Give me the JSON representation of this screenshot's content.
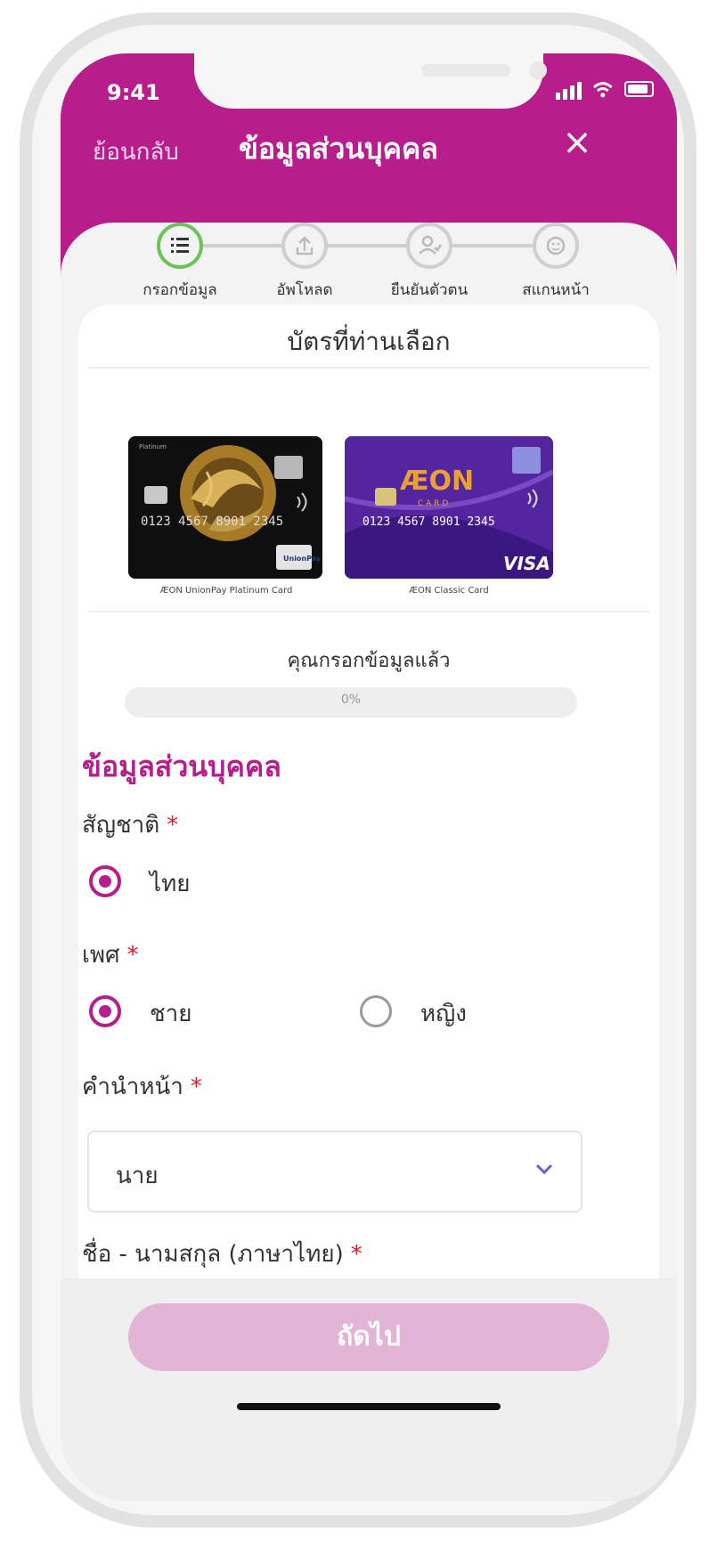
{
  "status_bar": {
    "time": "9:41"
  },
  "nav": {
    "back_label": "ย้อนกลับ",
    "title": "ข้อมูลส่วนบุคคล",
    "close_icon": "×"
  },
  "steps": [
    {
      "label": "กรอกข้อมูล",
      "icon": "list-icon",
      "active": true
    },
    {
      "label": "อัพโหลด",
      "icon": "upload-icon",
      "active": false
    },
    {
      "label": "ยืนยันตัวตน",
      "icon": "verify-user-icon",
      "active": false
    },
    {
      "label": "สแกนหน้า",
      "icon": "face-scan-icon",
      "active": false
    }
  ],
  "chosen_cards": {
    "title": "บัตรที่ท่านเลือก",
    "cards": [
      {
        "caption": "ÆON UnionPay Platinum Card",
        "number": "0123 4567 8901 2345",
        "badge_top": "Platinum",
        "network": "UnionPay"
      },
      {
        "caption": "ÆON Classic Card",
        "number": "0123 4567 8901 2345",
        "brand": "ÆON",
        "brand_sub": "C A R D",
        "network": "VISA"
      }
    ]
  },
  "progress": {
    "label": "คุณกรอกข้อมูลแล้ว",
    "percent": 0,
    "percent_text": "0%"
  },
  "section": {
    "title": "ข้อมูลส่วนบุคคล"
  },
  "form": {
    "nationality": {
      "label": "สัญชาติ",
      "required": "*",
      "options": [
        {
          "label": "ไทย",
          "selected": true
        }
      ]
    },
    "gender": {
      "label": "เพศ",
      "required": "*",
      "options": [
        {
          "label": "ชาย",
          "selected": true
        },
        {
          "label": "หญิง",
          "selected": false
        }
      ]
    },
    "prefix": {
      "label": "คำนำหน้า",
      "required": "*",
      "value": "นาย"
    },
    "fullname": {
      "label": "ชื่อ - นามสกุล (ภาษาไทย)",
      "required": "*"
    }
  },
  "footer": {
    "next_label": "ถัดไป"
  },
  "colors": {
    "brand": "#b81e8b",
    "step_active": "#6fc25a",
    "button_disabled": "#e2b4d6",
    "required": "#e11d2b"
  }
}
